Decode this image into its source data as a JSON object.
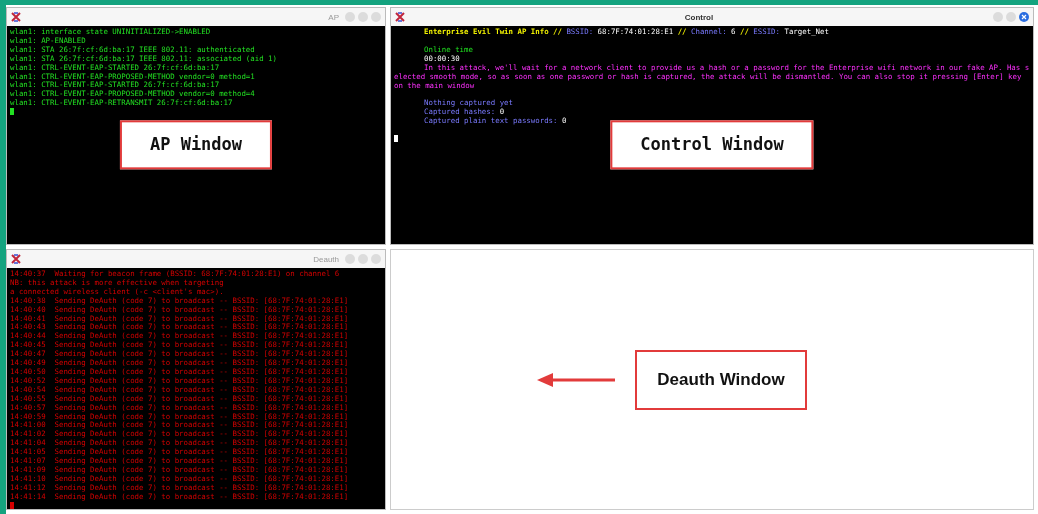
{
  "windows": [
    {
      "kind": "ap",
      "title": "AP",
      "callout": "AP Window",
      "lines": [
        "wlan1: interface state UNINITIALIZED->ENABLED",
        "wlan1: AP-ENABLED",
        "wlan1: STA 26:7f:cf:6d:ba:17 IEEE 802.11: authenticated",
        "wlan1: STA 26:7f:cf:6d:ba:17 IEEE 802.11: associated (aid 1)",
        "wlan1: CTRL-EVENT-EAP-STARTED 26:7f:cf:6d:ba:17",
        "wlan1: CTRL-EVENT-EAP-PROPOSED-METHOD vendor=0 method=1",
        "wlan1: CTRL-EVENT-EAP-STARTED 26:7f:cf:6d:ba:17",
        "wlan1: CTRL-EVENT-EAP-PROPOSED-METHOD vendor=0 method=4",
        "wlan1: CTRL-EVENT-EAP-RETRANSMIT 26:7f:cf:6d:ba:17"
      ]
    },
    {
      "kind": "control",
      "title": "Control",
      "callout": "Control Window",
      "blocks": [
        [
          [
            {
              "text": "Enterprise Evil Twin AP Info // ",
              "kind": "heading"
            },
            {
              "text": "BSSID: ",
              "kind": "label"
            },
            {
              "text": "68:7F:74:01:28:E1 ",
              "kind": "value"
            },
            {
              "text": "// ",
              "kind": "heading"
            },
            {
              "text": "Channel: ",
              "kind": "label"
            },
            {
              "text": "6 ",
              "kind": "value"
            },
            {
              "text": "// ",
              "kind": "heading"
            },
            {
              "text": "ESSID: ",
              "kind": "label"
            },
            {
              "text": "Target_Net",
              "kind": "value"
            }
          ]
        ],
        [
          [
            {
              "text": "Online time",
              "kind": "status"
            }
          ],
          [
            {
              "text": "00:00:30",
              "kind": "value"
            }
          ],
          [
            {
              "text": "In this attack, we'll wait for a network client to provide us a hash or a password for the Enterprise wifi network in our fake AP. Has selected smooth mode, so as soon as one password or hash is captured, the attack will be dismantled. You can also stop it pressing [Enter] key on the main window",
              "kind": "message"
            }
          ]
        ],
        [
          [
            {
              "text": "Nothing captured yet",
              "kind": "label"
            }
          ],
          [
            {
              "text": "Captured hashes: ",
              "kind": "label"
            },
            {
              "text": "0",
              "kind": "value"
            }
          ],
          [
            {
              "text": "Captured plain text passwords: ",
              "kind": "label"
            },
            {
              "text": "0",
              "kind": "value"
            }
          ]
        ]
      ]
    },
    {
      "kind": "deauth",
      "title": "Deauth",
      "lines": [
        "14:40:37  Waiting for beacon frame (BSSID: 68:7F:74:01:28:E1) on channel 6",
        "NB: this attack is more effective when targeting",
        "a connected wireless client (-c <client's mac>).",
        "14:40:38  Sending DeAuth (code 7) to broadcast -- BSSID: [68:7F:74:01:28:E1]",
        "14:40:40  Sending DeAuth (code 7) to broadcast -- BSSID: [68:7F:74:01:28:E1]",
        "14:40:41  Sending DeAuth (code 7) to broadcast -- BSSID: [68:7F:74:01:28:E1]",
        "14:40:43  Sending DeAuth (code 7) to broadcast -- BSSID: [68:7F:74:01:28:E1]",
        "14:40:44  Sending DeAuth (code 7) to broadcast -- BSSID: [68:7F:74:01:28:E1]",
        "14:40:45  Sending DeAuth (code 7) to broadcast -- BSSID: [68:7F:74:01:28:E1]",
        "14:40:47  Sending DeAuth (code 7) to broadcast -- BSSID: [68:7F:74:01:28:E1]",
        "14:40:49  Sending DeAuth (code 7) to broadcast -- BSSID: [68:7F:74:01:28:E1]",
        "14:40:50  Sending DeAuth (code 7) to broadcast -- BSSID: [68:7F:74:01:28:E1]",
        "14:40:52  Sending DeAuth (code 7) to broadcast -- BSSID: [68:7F:74:01:28:E1]",
        "14:40:54  Sending DeAuth (code 7) to broadcast -- BSSID: [68:7F:74:01:28:E1]",
        "14:40:55  Sending DeAuth (code 7) to broadcast -- BSSID: [68:7F:74:01:28:E1]",
        "14:40:57  Sending DeAuth (code 7) to broadcast -- BSSID: [68:7F:74:01:28:E1]",
        "14:40:59  Sending DeAuth (code 7) to broadcast -- BSSID: [68:7F:74:01:28:E1]",
        "14:41:00  Sending DeAuth (code 7) to broadcast -- BSSID: [68:7F:74:01:28:E1]",
        "14:41:02  Sending DeAuth (code 7) to broadcast -- BSSID: [68:7F:74:01:28:E1]",
        "14:41:04  Sending DeAuth (code 7) to broadcast -- BSSID: [68:7F:74:01:28:E1]",
        "14:41:05  Sending DeAuth (code 7) to broadcast -- BSSID: [68:7F:74:01:28:E1]",
        "14:41:07  Sending DeAuth (code 7) to broadcast -- BSSID: [68:7F:74:01:28:E1]",
        "14:41:09  Sending DeAuth (code 7) to broadcast -- BSSID: [68:7F:74:01:28:E1]",
        "14:41:10  Sending DeAuth (code 7) to broadcast -- BSSID: [68:7F:74:01:28:E1]",
        "14:41:12  Sending DeAuth (code 7) to broadcast -- BSSID: [68:7F:74:01:28:E1]",
        "14:41:14  Sending DeAuth (code 7) to broadcast -- BSSID: [68:7F:74:01:28:E1]"
      ]
    }
  ],
  "pointer_callout": "Deauth Window"
}
